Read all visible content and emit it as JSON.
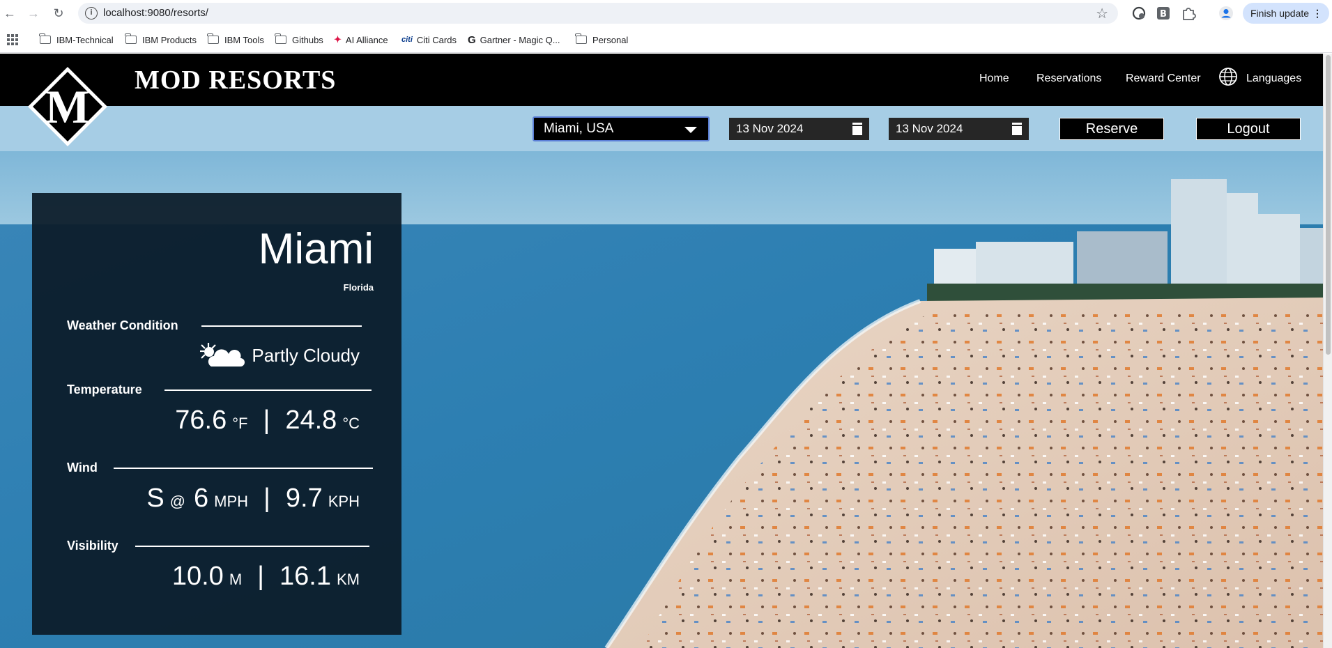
{
  "browser": {
    "url": "localhost:9080/resorts/",
    "finish_update_label": "Finish update",
    "bookmarks": [
      {
        "label": "IBM-Technical",
        "icon": "folder-icon"
      },
      {
        "label": "IBM Products",
        "icon": "folder-icon"
      },
      {
        "label": "IBM Tools",
        "icon": "folder-icon"
      },
      {
        "label": "Githubs",
        "icon": "folder-icon"
      },
      {
        "label": "AI Alliance",
        "icon": "ai-alliance-icon"
      },
      {
        "label": "Citi Cards",
        "icon": "citi-icon"
      },
      {
        "label": "Gartner - Magic Q...",
        "icon": "google-icon"
      },
      {
        "label": "Personal",
        "icon": "folder-icon"
      }
    ]
  },
  "site": {
    "brand": "MOD RESORTS",
    "logo_letter": "M",
    "nav": {
      "home": "Home",
      "reservations": "Reservations",
      "reward_center": "Reward Center",
      "languages": "Languages"
    }
  },
  "booking": {
    "location": "Miami, USA",
    "check_in": "13 Nov 2024",
    "check_out": "13 Nov 2024",
    "reserve_label": "Reserve",
    "logout_label": "Logout"
  },
  "weather": {
    "city": "Miami",
    "state": "Florida",
    "condition_label": "Weather Condition",
    "condition": "Partly Cloudy",
    "temperature_label": "Temperature",
    "temp_f": "76.6",
    "temp_f_unit": "°F",
    "temp_c": "24.8",
    "temp_c_unit": "°C",
    "wind_label": "Wind",
    "wind_dir": "S",
    "wind_at": "@",
    "wind_mph": "6",
    "wind_mph_unit": "MPH",
    "wind_kph": "9.7",
    "wind_kph_unit": "KPH",
    "visibility_label": "Visibility",
    "vis_m": "10.0",
    "vis_m_unit": "M",
    "vis_km": "16.1",
    "vis_km_unit": "KM",
    "separator": "|"
  },
  "colors": {
    "header_bg": "#000000",
    "subheader_bg": "#a6cde5",
    "panel_bg": "#0b1b28",
    "select_border": "#5b7fd7"
  }
}
